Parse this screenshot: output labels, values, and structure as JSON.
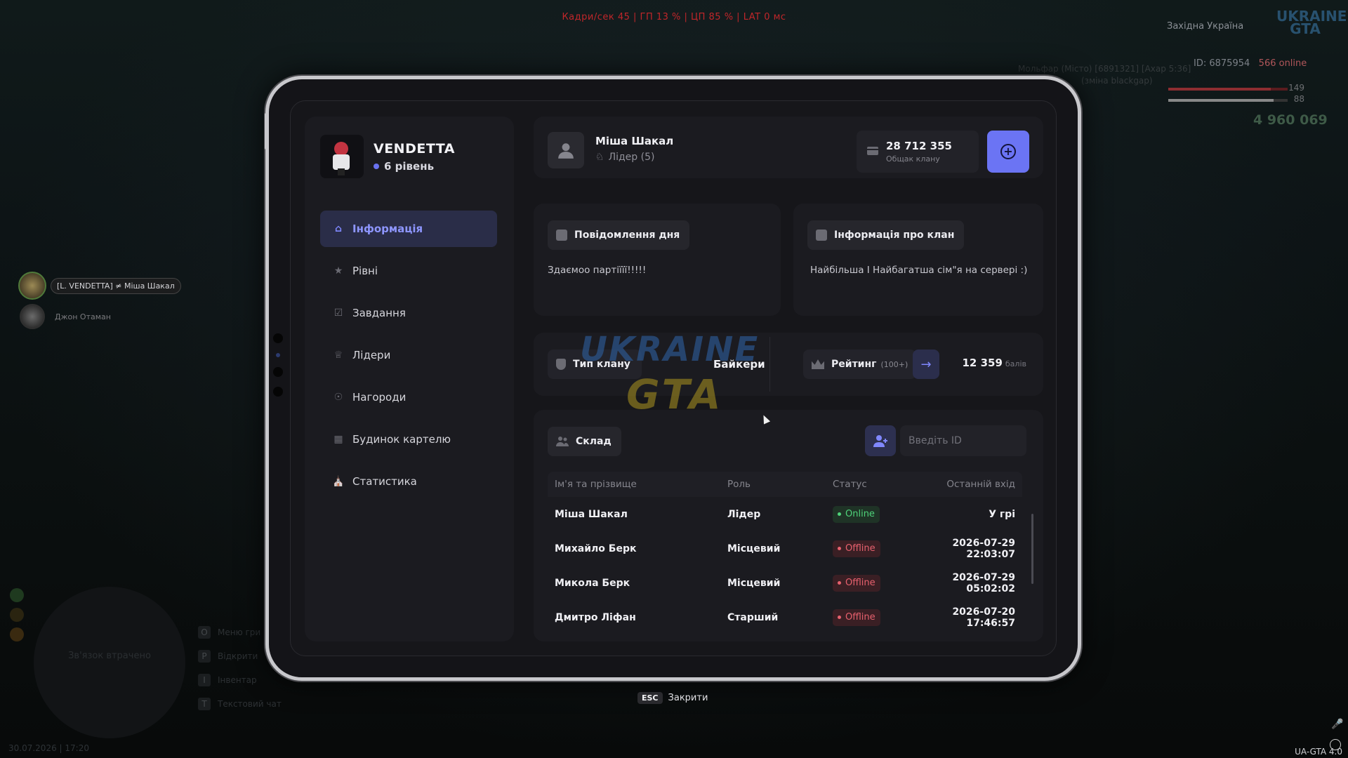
{
  "hud": {
    "top_stats": "Кадри/сек 45 | ГП 13 % | ЦП 85 % | LAT 0 мс",
    "region": "Західна Україна",
    "logo": "UKRAINE GTA",
    "player_id": "ID: 6875954",
    "online": "566 online",
    "health": "149",
    "armor": "88",
    "money": "4 960 069",
    "bg_text1": "Мольфар (Місто) [6891321] [Ахар 5:36]",
    "bg_text2": "(зміна blackgap)"
  },
  "players": [
    {
      "name": "[L. VENDETTA] ≠ Міша Шакал"
    },
    {
      "name": "Джон Отаман"
    }
  ],
  "radar_text": "Зв'язок втрачено",
  "hints": [
    {
      "key": "O",
      "label": "Меню гри"
    },
    {
      "key": "P",
      "label": "Відкрити"
    },
    {
      "key": "I",
      "label": "Інвентар"
    },
    {
      "key": "T",
      "label": "Текстовий чат"
    }
  ],
  "datestamp": "30.07.2026 | 17:20",
  "version": "UA-GTA 4.0",
  "clan": {
    "name": "VENDETTA",
    "level": "6 рівень"
  },
  "nav": [
    {
      "label": "Інформація",
      "icon": "home-icon",
      "active": true
    },
    {
      "label": "Рівні",
      "icon": "star-icon"
    },
    {
      "label": "Завдання",
      "icon": "checkbox-icon"
    },
    {
      "label": "Лідери",
      "icon": "crown-icon"
    },
    {
      "label": "Нагороди",
      "icon": "medal-icon"
    },
    {
      "label": "Будинок картелю",
      "icon": "chart-icon"
    },
    {
      "label": "Статистика",
      "icon": "store-icon"
    }
  ],
  "profile": {
    "name": "Міша Шакал",
    "role": "Лідер (5)"
  },
  "bank": {
    "value": "28 712 355",
    "label": "Общак клану"
  },
  "motd": {
    "title": "Повідомлення дня",
    "text": "Здаємоо партіїїї!!!!!"
  },
  "about": {
    "title": "Інформація про клан",
    "text": "Найбільша І Найбагатша сім\"я на сервері :)"
  },
  "clan_type": {
    "label": "Тип клану",
    "value": "Байкери"
  },
  "rating": {
    "label": "Рейтинг",
    "sub": "(100+)",
    "points": "12 359",
    "points_unit": "балів"
  },
  "roster": {
    "title": "Склад",
    "id_placeholder": "Введіть ID",
    "headers": [
      "Ім'я та прізвище",
      "Роль",
      "Статус",
      "Останній вхід"
    ],
    "rows": [
      {
        "name": "Міша Шакал",
        "role": "Лідер",
        "status": "Online",
        "last": "У грі"
      },
      {
        "name": "Михайло Берк",
        "role": "Місцевий",
        "status": "Offline",
        "last": "2026-07-29 22:03:07"
      },
      {
        "name": "Микола Берк",
        "role": "Місцевий",
        "status": "Offline",
        "last": "2026-07-29 05:02:02"
      },
      {
        "name": "Дмитро Ліфан",
        "role": "Старший",
        "status": "Offline",
        "last": "2026-07-20 17:46:57"
      }
    ]
  },
  "close_hint": {
    "key": "ESC",
    "label": "Закрити"
  },
  "watermark": {
    "line1": "UKRAINE",
    "line2": "GTA"
  },
  "colors": {
    "accent": "#6b74f4",
    "online": "#4fd37a",
    "offline": "#e8616e"
  }
}
